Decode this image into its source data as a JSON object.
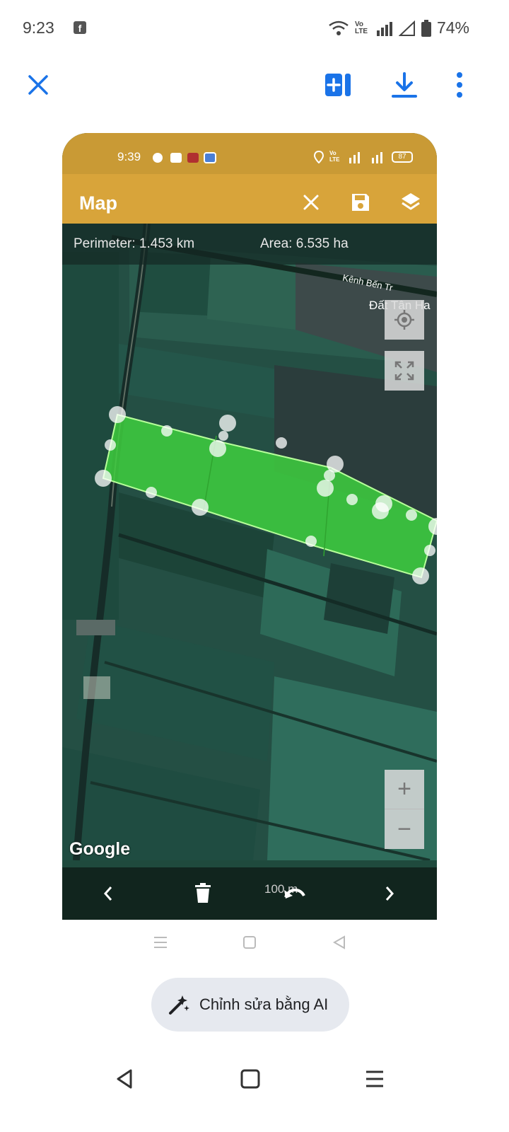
{
  "status_bar": {
    "time": "9:23",
    "notification_icon": "facebook-icon",
    "network_label": "Vo LTE",
    "battery": "74%"
  },
  "toolbar": {
    "close_icon": "close-icon",
    "add_icon": "add-to-collection-icon",
    "download_icon": "download-icon",
    "more_icon": "more-vert-icon"
  },
  "screenshot": {
    "status_time": "9:39",
    "network_label": "Vo LTE",
    "battery": "87",
    "app_title": "Map",
    "perimeter": "Perimeter: 1.453 km",
    "area": "Area: 6.535 ha",
    "map_labels": [
      "Kênh Bến Tr",
      "Đất Tân Ha"
    ],
    "google_logo": "Google",
    "zoom_in": "+",
    "zoom_out": "−",
    "scale_label": "100 m",
    "colors": {
      "header": "#d8a43a",
      "status": "#c99a35",
      "polygon_fill": "#3ecf3e"
    }
  },
  "ai_button": {
    "label": "Chỉnh sửa bằng AI"
  }
}
